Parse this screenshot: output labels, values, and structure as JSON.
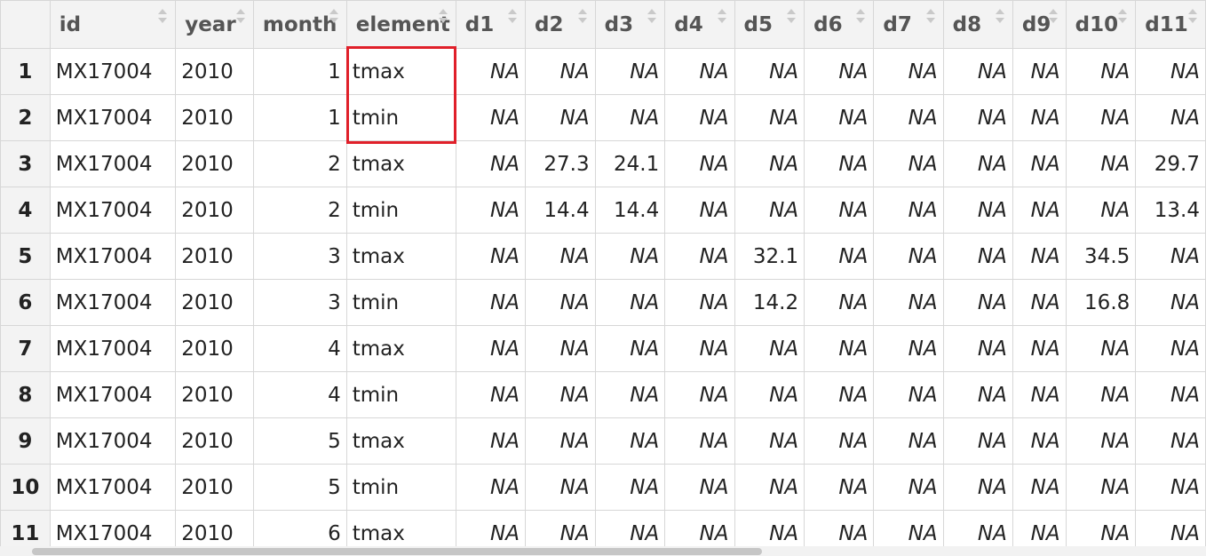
{
  "table": {
    "columns": [
      {
        "label": "",
        "kind": "rownum"
      },
      {
        "label": "id",
        "kind": "txt"
      },
      {
        "label": "year",
        "kind": "txt"
      },
      {
        "label": "month",
        "kind": "num"
      },
      {
        "label": "element",
        "kind": "txt"
      },
      {
        "label": "d1",
        "kind": "num"
      },
      {
        "label": "d2",
        "kind": "num"
      },
      {
        "label": "d3",
        "kind": "num"
      },
      {
        "label": "d4",
        "kind": "num"
      },
      {
        "label": "d5",
        "kind": "num"
      },
      {
        "label": "d6",
        "kind": "num"
      },
      {
        "label": "d7",
        "kind": "num"
      },
      {
        "label": "d8",
        "kind": "num"
      },
      {
        "label": "d9",
        "kind": "num"
      },
      {
        "label": "d10",
        "kind": "num"
      },
      {
        "label": "d11",
        "kind": "num"
      }
    ],
    "na_label": "NA",
    "rows": [
      [
        "1",
        "MX17004",
        "2010",
        "1",
        "tmax",
        null,
        null,
        null,
        null,
        null,
        null,
        null,
        null,
        null,
        null,
        null
      ],
      [
        "2",
        "MX17004",
        "2010",
        "1",
        "tmin",
        null,
        null,
        null,
        null,
        null,
        null,
        null,
        null,
        null,
        null,
        null
      ],
      [
        "3",
        "MX17004",
        "2010",
        "2",
        "tmax",
        null,
        "27.3",
        "24.1",
        null,
        null,
        null,
        null,
        null,
        null,
        null,
        "29.7"
      ],
      [
        "4",
        "MX17004",
        "2010",
        "2",
        "tmin",
        null,
        "14.4",
        "14.4",
        null,
        null,
        null,
        null,
        null,
        null,
        null,
        "13.4"
      ],
      [
        "5",
        "MX17004",
        "2010",
        "3",
        "tmax",
        null,
        null,
        null,
        null,
        "32.1",
        null,
        null,
        null,
        null,
        "34.5",
        null
      ],
      [
        "6",
        "MX17004",
        "2010",
        "3",
        "tmin",
        null,
        null,
        null,
        null,
        "14.2",
        null,
        null,
        null,
        null,
        "16.8",
        null
      ],
      [
        "7",
        "MX17004",
        "2010",
        "4",
        "tmax",
        null,
        null,
        null,
        null,
        null,
        null,
        null,
        null,
        null,
        null,
        null
      ],
      [
        "8",
        "MX17004",
        "2010",
        "4",
        "tmin",
        null,
        null,
        null,
        null,
        null,
        null,
        null,
        null,
        null,
        null,
        null
      ],
      [
        "9",
        "MX17004",
        "2010",
        "5",
        "tmax",
        null,
        null,
        null,
        null,
        null,
        null,
        null,
        null,
        null,
        null,
        null
      ],
      [
        "10",
        "MX17004",
        "2010",
        "5",
        "tmin",
        null,
        null,
        null,
        null,
        null,
        null,
        null,
        null,
        null,
        null,
        null
      ],
      [
        "11",
        "MX17004",
        "2010",
        "6",
        "tmax",
        null,
        null,
        null,
        null,
        null,
        null,
        null,
        null,
        null,
        null,
        null
      ]
    ]
  },
  "colors": {
    "highlight": "#e0202a",
    "header_bg": "#f3f3f3",
    "na_text": "#b9b9b9",
    "grid_line": "#d7d7d7"
  }
}
